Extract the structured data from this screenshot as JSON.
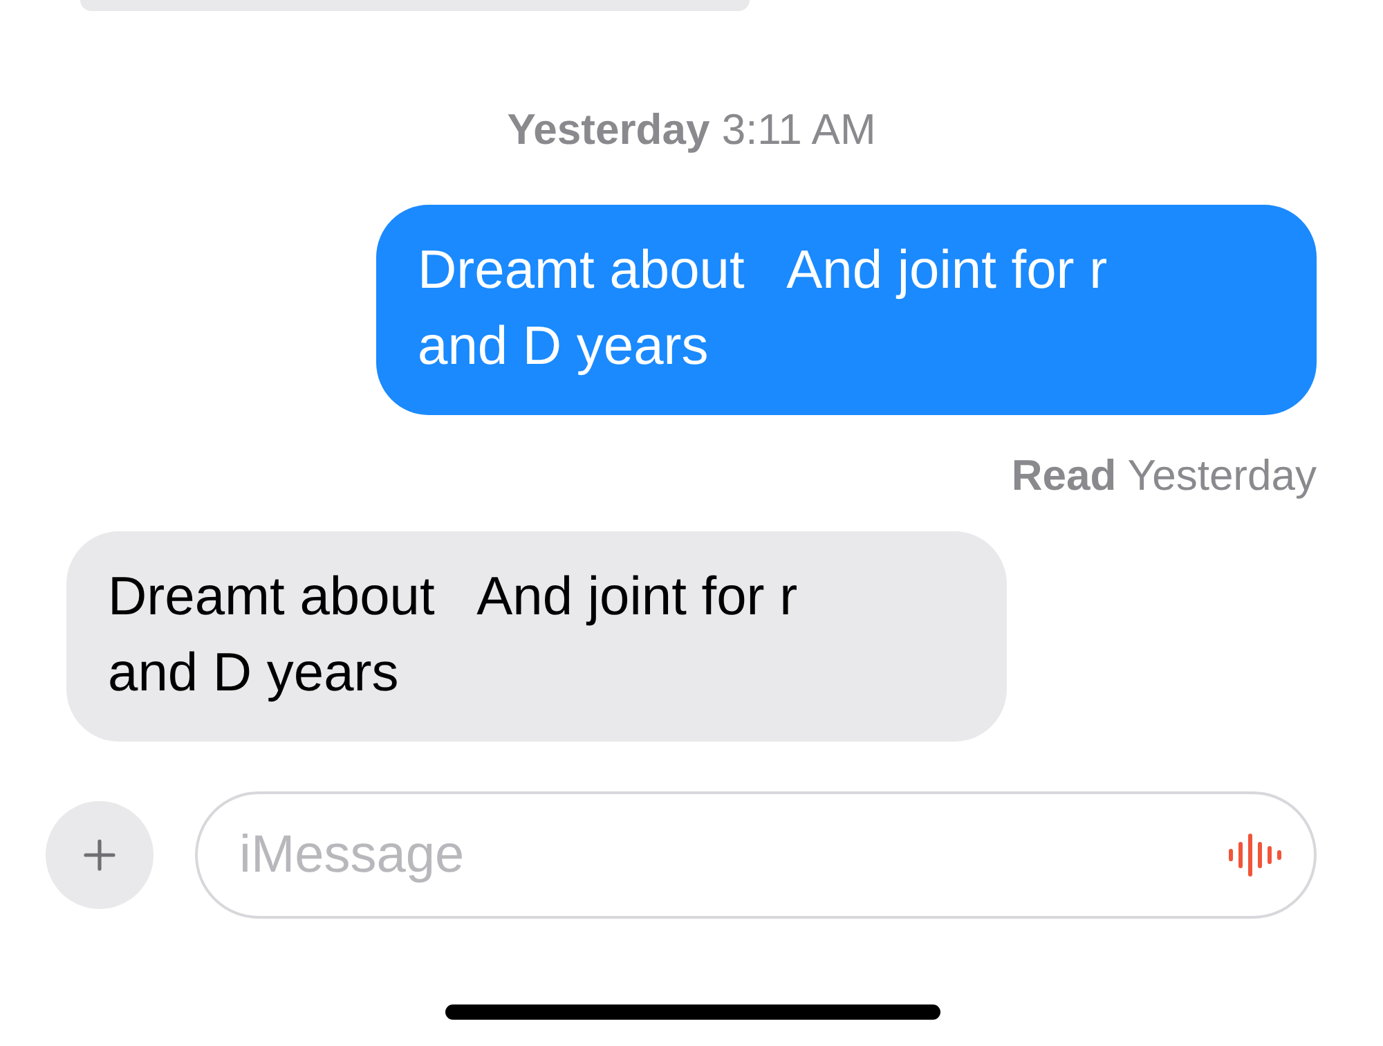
{
  "timestamp": "**Yesterday** 3:11 AM",
  "messages": [
    {
      "kind": "outgoing",
      "text": "Dreamt about   And joint for r and D years"
    },
    {
      "kind": "receipt",
      "text": "**Read** Yesterday"
    },
    {
      "kind": "incoming",
      "text": "Dreamt about   And joint for r and D years"
    }
  ],
  "composer": {
    "placeholder": "iMessage"
  }
}
